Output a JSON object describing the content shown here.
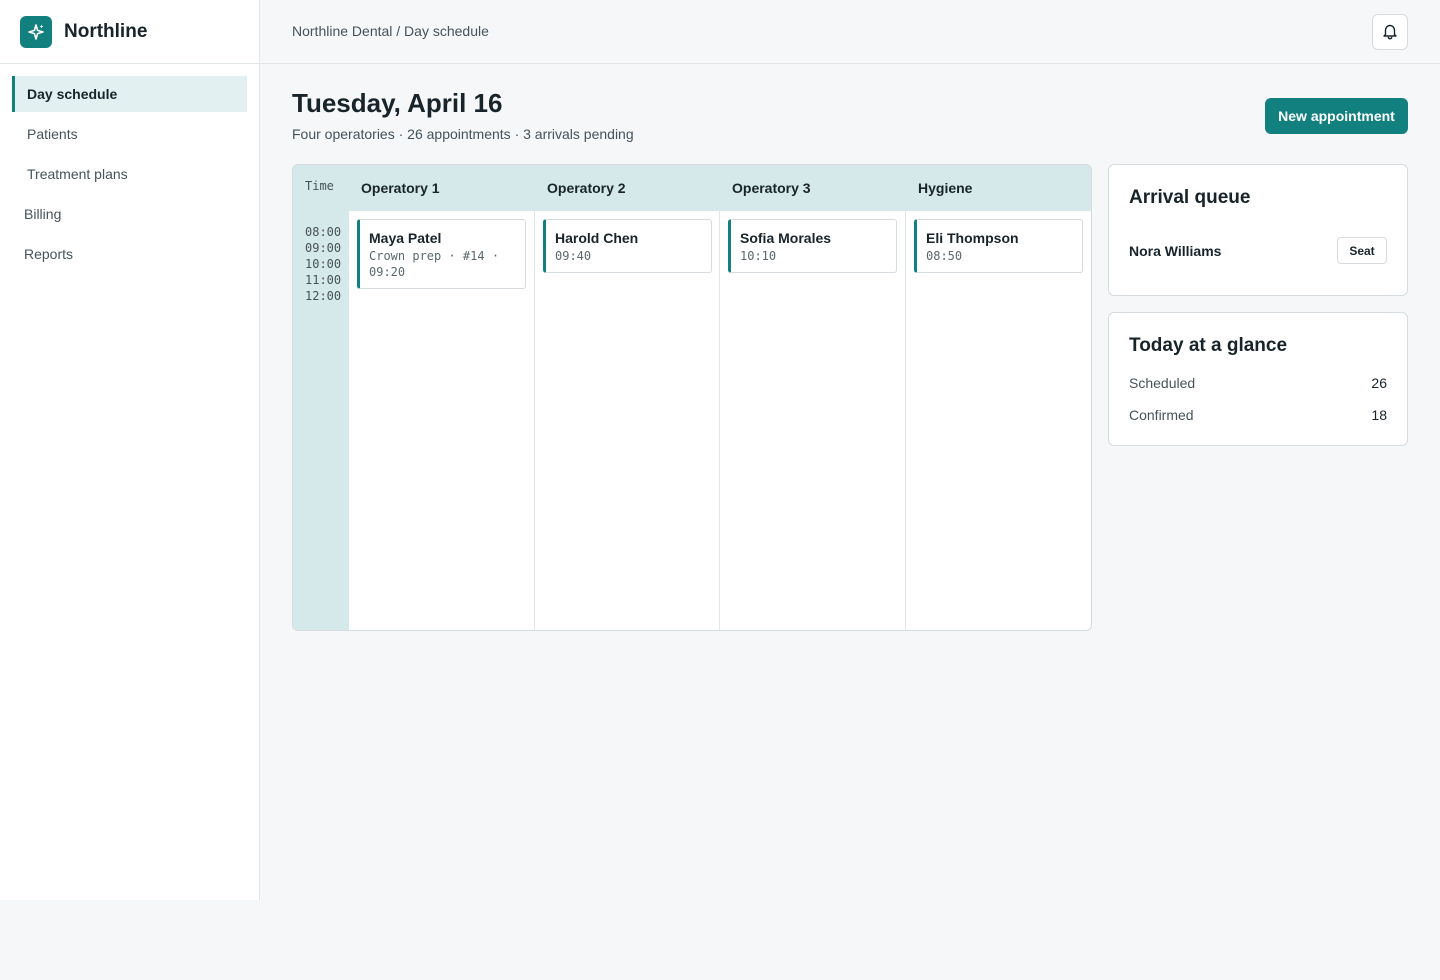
{
  "brand": {
    "name": "Northline"
  },
  "sidebar": {
    "items": [
      {
        "label": "Day schedule"
      },
      {
        "label": "Patients"
      },
      {
        "label": "Treatment plans"
      },
      {
        "label": "Billing"
      },
      {
        "label": "Reports"
      }
    ]
  },
  "header": {
    "breadcrumb": "Northline Dental / Day schedule"
  },
  "page": {
    "title": "Tuesday, April 16",
    "subtitle": "Four operatories · 26 appointments · 3 arrivals pending",
    "new_button": "New appointment"
  },
  "schedule": {
    "time_label": "Time",
    "times": [
      "08:00",
      "09:00",
      "10:00",
      "11:00",
      "12:00"
    ],
    "columns": [
      {
        "label": "Operatory 1",
        "appointment": {
          "name": "Maya Patel",
          "detail": "Crown prep · #14 · 09:20"
        }
      },
      {
        "label": "Operatory 2",
        "appointment": {
          "name": "Harold Chen",
          "detail": "09:40"
        }
      },
      {
        "label": "Operatory 3",
        "appointment": {
          "name": "Sofia Morales",
          "detail": "10:10"
        }
      },
      {
        "label": "Hygiene",
        "appointment": {
          "name": "Eli Thompson",
          "detail": "08:50"
        }
      }
    ]
  },
  "arrival_queue": {
    "title": "Arrival queue",
    "patient": "Nora Williams",
    "seat_label": "Seat"
  },
  "glance": {
    "title": "Today at a glance",
    "stats": [
      {
        "label": "Scheduled",
        "value": "26"
      },
      {
        "label": "Confirmed",
        "value": "18"
      }
    ]
  },
  "colors": {
    "accent": "#12807f",
    "accent_soft": "#d5e8ea"
  },
  "icons": {
    "logo": "sparkle-icon",
    "notifications": "bell-icon"
  }
}
